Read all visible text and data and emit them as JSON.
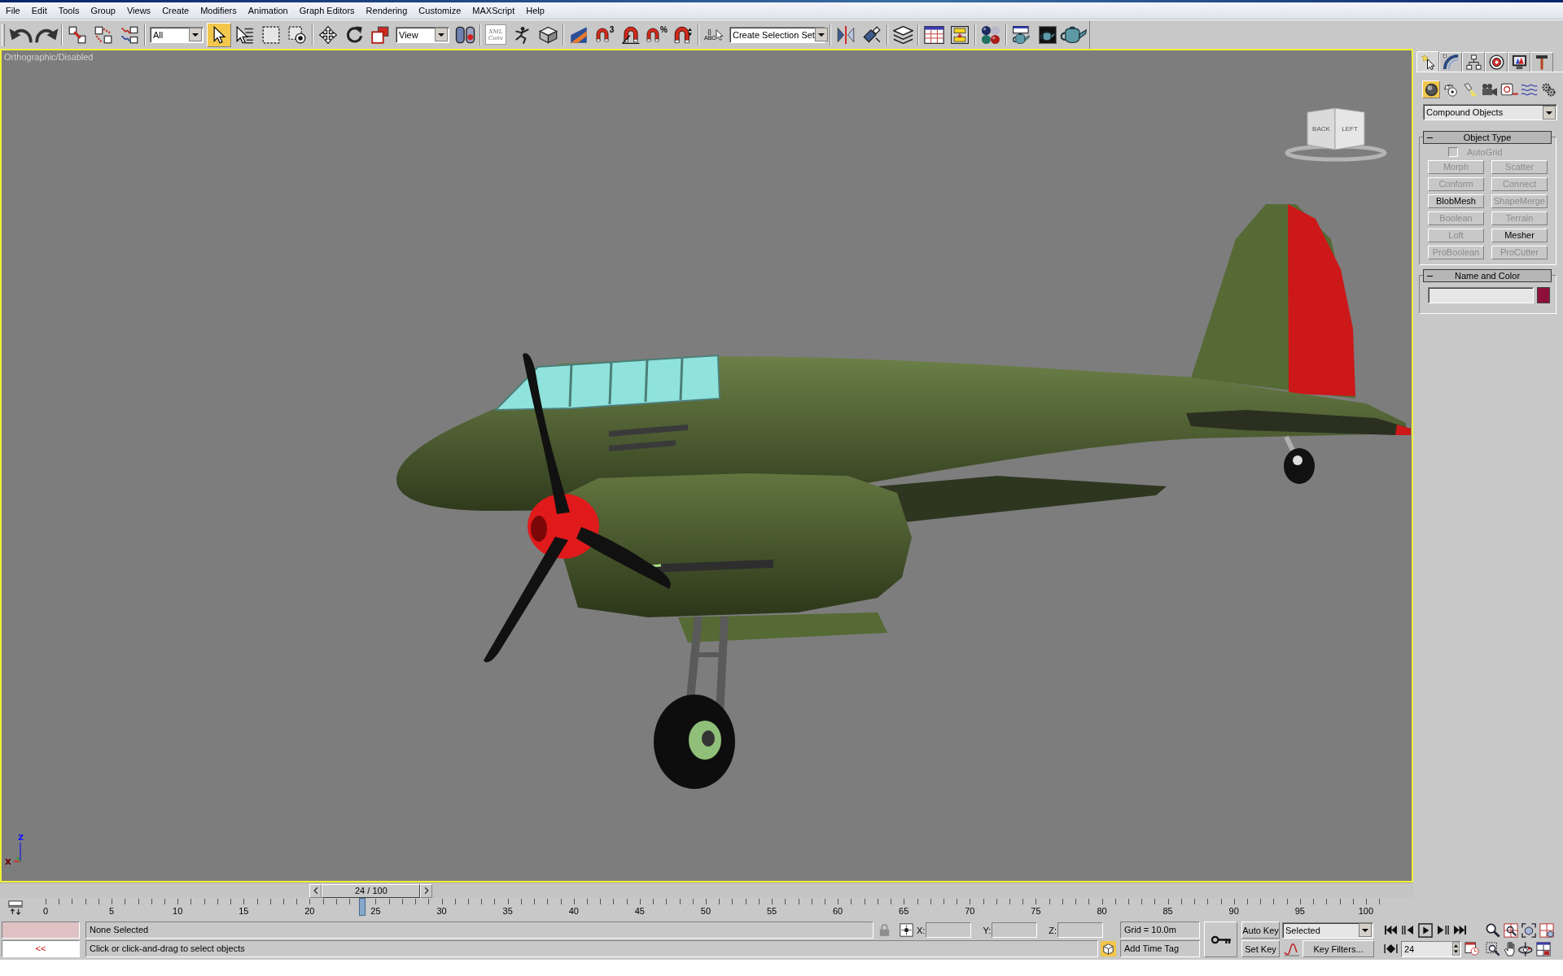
{
  "menu_bar": [
    "File",
    "Edit",
    "Tools",
    "Group",
    "Views",
    "Create",
    "Modifiers",
    "Animation",
    "Graph Editors",
    "Rendering",
    "Customize",
    "MAXScript",
    "Help"
  ],
  "main_toolbar": [
    [
      {
        "kind": "button"
      },
      {
        "kind": "button"
      }
    ],
    [
      {
        "kind": "tool",
        "selected": false
      },
      {
        "kind": "tool",
        "selected": false
      },
      {
        "kind": "tool",
        "selected": false
      }
    ],
    [
      {
        "kind": "dropdown",
        "value": "All"
      },
      {
        "kind": "tool",
        "selected": true
      },
      {
        "kind": "button"
      },
      {
        "kind": "tool",
        "selected": false
      },
      {
        "kind": "tool",
        "selected": false
      }
    ],
    [
      {
        "kind": "tool",
        "selected": false
      },
      {
        "kind": "tool",
        "selected": false
      },
      {
        "kind": "tool",
        "selected": false
      },
      {
        "kind": "dropdown",
        "value": "View"
      },
      {
        "kind": "button"
      }
    ],
    [
      {
        "kind": "label_button",
        "label": "XML Conv"
      },
      {
        "kind": "tool",
        "selected": false
      },
      {
        "kind": "tool",
        "selected": false
      }
    ],
    [
      {
        "kind": "tool",
        "selected": false
      },
      {
        "kind": "tool",
        "selected": false,
        "badge": "3"
      },
      {
        "kind": "tool",
        "selected": false
      },
      {
        "kind": "tool",
        "selected": false,
        "badge": "%"
      },
      {
        "kind": "tool",
        "selected": false
      }
    ],
    [
      {
        "kind": "button",
        "badge": "{} ABC"
      },
      {
        "kind": "dropdown",
        "value": "Create Selection Set"
      }
    ],
    [
      {
        "kind": "button"
      },
      {
        "kind": "button"
      }
    ],
    [
      {
        "kind": "button"
      }
    ],
    [
      {
        "kind": "button"
      },
      {
        "kind": "button"
      }
    ],
    [
      {
        "kind": "button"
      }
    ],
    [
      {
        "kind": "button"
      },
      {
        "kind": "button"
      },
      {
        "kind": "button"
      }
    ]
  ],
  "viewport": {
    "label": "Orthographic/Disabled",
    "active": true,
    "view_cube": [
      "BACK",
      "LEFT"
    ],
    "axis_labels": [
      "z",
      "x"
    ]
  },
  "time_slider": {
    "label": "24 / 100",
    "level": 0.24
  },
  "track_bar": {
    "labels": [
      "0",
      "5",
      "10",
      "15",
      "20",
      "25",
      "30",
      "35",
      "40",
      "45",
      "50",
      "55",
      "60",
      "65",
      "70",
      "75",
      "80",
      "85",
      "90",
      "95",
      "100"
    ],
    "level": 0.24
  },
  "command_panel": {
    "tabs": [
      {
        "selected": true
      },
      {
        "selected": false
      },
      {
        "selected": false
      },
      {
        "selected": false
      },
      {
        "selected": false
      },
      {
        "selected": false
      }
    ],
    "categories": [
      {
        "selected": true
      },
      {
        "selected": false
      },
      {
        "selected": false
      },
      {
        "selected": false
      },
      {
        "selected": false
      },
      {
        "selected": false
      },
      {
        "selected": false
      }
    ],
    "category_dropdown": "Compound Objects",
    "rollouts": [
      {
        "kind": "object_type",
        "title": "Object Type",
        "expanded": true,
        "autogrid": {
          "label": "AutoGrid",
          "checked": false,
          "disabled": true
        },
        "buttons": [
          {
            "label": "Morph",
            "disabled": true
          },
          {
            "label": "Scatter",
            "disabled": true
          },
          {
            "label": "Conform",
            "disabled": true
          },
          {
            "label": "Connect",
            "disabled": true
          },
          {
            "label": "BlobMesh",
            "disabled": false
          },
          {
            "label": "ShapeMerge",
            "disabled": true
          },
          {
            "label": "Boolean",
            "disabled": true
          },
          {
            "label": "Terrain",
            "disabled": true
          },
          {
            "label": "Loft",
            "disabled": true
          },
          {
            "label": "Mesher",
            "disabled": false
          },
          {
            "label": "ProBoolean",
            "disabled": true
          },
          {
            "label": "ProCutter",
            "disabled": true
          }
        ]
      },
      {
        "kind": "name_color",
        "title": "Name and Color",
        "expanded": true
      }
    ]
  },
  "status_bar": {
    "listener_prompt": "<<",
    "selection": "None Selected",
    "prompt": "Click or click-and-drag to select objects",
    "coordinates": [
      "X:",
      "Y:",
      "Z:"
    ],
    "grid": "Grid = 10.0m",
    "time_tag": "Add Time Tag",
    "auto_key": {
      "label": "Auto Key",
      "on": false
    },
    "key_filter": "Selected",
    "set_key": "Set Key",
    "key_filters": "Key Filters...",
    "current_frame": "24"
  }
}
